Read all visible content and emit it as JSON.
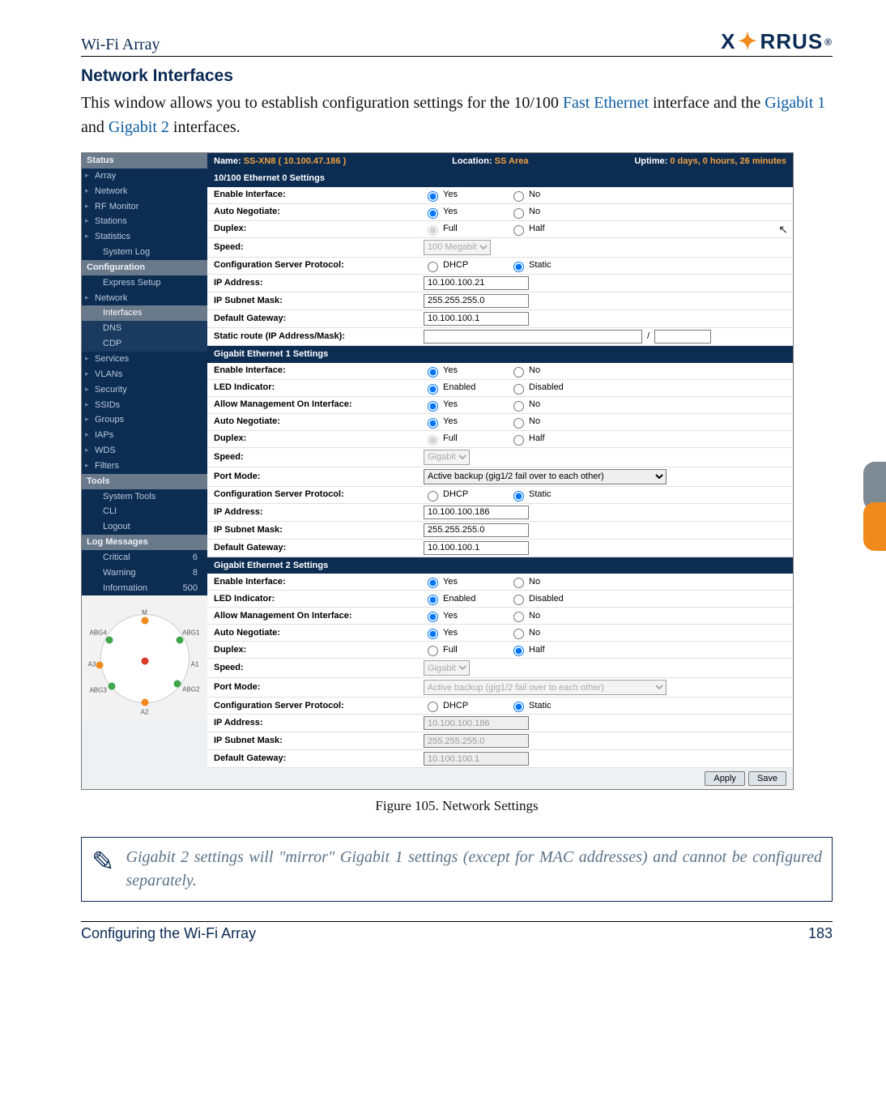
{
  "header": {
    "left": "Wi-Fi Array",
    "logo_left": "X",
    "logo_right": "RRUS"
  },
  "section_title": "Network Interfaces",
  "intro_pre": "This window allows you to establish configuration settings for the 10/100 ",
  "intro_link1": "Fast Ethernet",
  "intro_mid1": " interface and the ",
  "intro_link2": "Gigabit 1",
  "intro_mid2": " and ",
  "intro_link3": "Gigabit 2",
  "intro_post": " interfaces.",
  "figcap": "Figure 105. Network Settings",
  "note": "Gigabit 2 settings will \"mirror\" Gigabit 1 settings (except for MAC addresses) and cannot be configured separately.",
  "footer": {
    "left": "Configuring the Wi-Fi Array",
    "right": "183"
  },
  "nav": {
    "status_hdr": "Status",
    "status_items": [
      "Array",
      "Network",
      "RF Monitor",
      "Stations",
      "Statistics",
      "System Log"
    ],
    "config_hdr": "Configuration",
    "config_items": [
      "Express Setup",
      "Network"
    ],
    "config_sub": [
      "Interfaces",
      "DNS",
      "CDP"
    ],
    "config_items2": [
      "Services",
      "VLANs",
      "Security",
      "SSIDs",
      "Groups",
      "IAPs",
      "WDS",
      "Filters"
    ],
    "tools_hdr": "Tools",
    "tools_items": [
      "System Tools",
      "CLI",
      "Logout"
    ],
    "log_hdr": "Log Messages",
    "log_items": [
      {
        "label": "Critical",
        "count": "6"
      },
      {
        "label": "Warning",
        "count": "8"
      },
      {
        "label": "Information",
        "count": "500"
      }
    ]
  },
  "status": {
    "name_lbl": "Name:",
    "name_val": "SS-XN8   ( 10.100.47.186 )",
    "loc_lbl": "Location:",
    "loc_val": "SS Area",
    "uptime_lbl": "Uptime:",
    "uptime_val": "0 days, 0 hours, 26 minutes"
  },
  "s0": {
    "title": "10/100 Ethernet 0 Settings",
    "enable": {
      "label": "Enable Interface:",
      "a": "Yes",
      "b": "No",
      "sel": "a"
    },
    "auto": {
      "label": "Auto Negotiate:",
      "a": "Yes",
      "b": "No",
      "sel": "a"
    },
    "duplex": {
      "label": "Duplex:",
      "a": "Full",
      "b": "Half",
      "sel": "a"
    },
    "speed": {
      "label": "Speed:",
      "value": "100 Megabit"
    },
    "csp": {
      "label": "Configuration Server Protocol:",
      "a": "DHCP",
      "b": "Static",
      "sel": "b"
    },
    "ip": {
      "label": "IP Address:",
      "value": "10.100.100.21"
    },
    "mask": {
      "label": "IP Subnet Mask:",
      "value": "255.255.255.0"
    },
    "gw": {
      "label": "Default Gateway:",
      "value": "10.100.100.1"
    },
    "route": {
      "label": "Static route (IP Address/Mask):",
      "v1": "",
      "v2": ""
    }
  },
  "s1": {
    "title": "Gigabit Ethernet 1 Settings",
    "enable": {
      "label": "Enable Interface:",
      "a": "Yes",
      "b": "No",
      "sel": "a"
    },
    "led": {
      "label": "LED Indicator:",
      "a": "Enabled",
      "b": "Disabled",
      "sel": "a"
    },
    "mgmt": {
      "label": "Allow Management On Interface:",
      "a": "Yes",
      "b": "No",
      "sel": "a"
    },
    "auto": {
      "label": "Auto Negotiate:",
      "a": "Yes",
      "b": "No",
      "sel": "a"
    },
    "duplex": {
      "label": "Duplex:",
      "a": "Full",
      "b": "Half",
      "sel": "a"
    },
    "speed": {
      "label": "Speed:",
      "value": "Gigabit"
    },
    "port": {
      "label": "Port Mode:",
      "value": "Active backup (gig1/2 fail over to each other)"
    },
    "csp": {
      "label": "Configuration Server Protocol:",
      "a": "DHCP",
      "b": "Static",
      "sel": "b"
    },
    "ip": {
      "label": "IP Address:",
      "value": "10.100.100.186"
    },
    "mask": {
      "label": "IP Subnet Mask:",
      "value": "255.255.255.0"
    },
    "gw": {
      "label": "Default Gateway:",
      "value": "10.100.100.1"
    }
  },
  "s2": {
    "title": "Gigabit Ethernet 2 Settings",
    "enable": {
      "label": "Enable Interface:",
      "a": "Yes",
      "b": "No",
      "sel": "a"
    },
    "led": {
      "label": "LED Indicator:",
      "a": "Enabled",
      "b": "Disabled",
      "sel": "a"
    },
    "mgmt": {
      "label": "Allow Management On Interface:",
      "a": "Yes",
      "b": "No",
      "sel": "a"
    },
    "auto": {
      "label": "Auto Negotiate:",
      "a": "Yes",
      "b": "No",
      "sel": "a"
    },
    "duplex": {
      "label": "Duplex:",
      "a": "Full",
      "b": "Half",
      "sel": "b"
    },
    "speed": {
      "label": "Speed:",
      "value": "Gigabit"
    },
    "port": {
      "label": "Port Mode:",
      "value": "Active backup (gig1/2 fail over to each other)"
    },
    "csp": {
      "label": "Configuration Server Protocol:",
      "a": "DHCP",
      "b": "Static",
      "sel": "b"
    },
    "ip": {
      "label": "IP Address:",
      "value": "10.100.100.186"
    },
    "mask": {
      "label": "IP Subnet Mask:",
      "value": "255.255.255.0"
    },
    "gw": {
      "label": "Default Gateway:",
      "value": "10.100.100.1"
    }
  },
  "buttons": {
    "apply": "Apply",
    "save": "Save"
  },
  "device_labels": {
    "a1": "A1",
    "a2": "A2",
    "a3": "A3",
    "m": "M",
    "abg1": "ABG1",
    "abg2": "ABG2",
    "abg3": "ABG3",
    "abg4": "ABG4"
  },
  "slash": "/"
}
